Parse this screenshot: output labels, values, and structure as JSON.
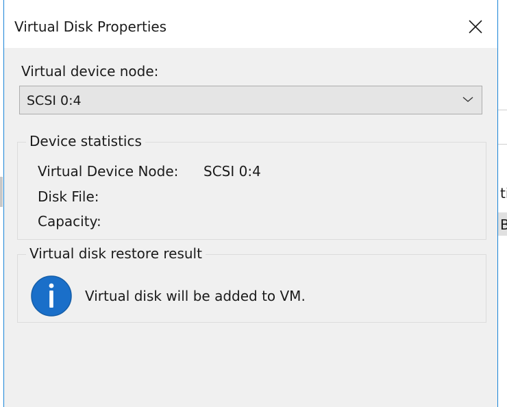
{
  "dialog": {
    "title": "Virtual Disk Properties",
    "close_icon": "close-icon"
  },
  "node": {
    "label": "Virtual device node:",
    "selected": "SCSI 0:4",
    "dropdown_icon": "chevron-down-icon"
  },
  "stats": {
    "legend": "Device statistics",
    "rows": [
      {
        "label": "Virtual Device Node:",
        "value": "SCSI 0:4"
      },
      {
        "label": "Disk File:",
        "value": ""
      },
      {
        "label": "Capacity:",
        "value": ""
      }
    ]
  },
  "restore": {
    "legend": "Virtual disk restore result",
    "message": "Virtual disk will be added to VM.",
    "icon": "info-icon"
  },
  "background": {
    "right_text_1": "ti",
    "right_text_2": "B"
  },
  "colors": {
    "accent_border": "#1883d7",
    "info_icon_fill": "#1a6fc9",
    "dialog_bg": "#f0f0f0"
  }
}
